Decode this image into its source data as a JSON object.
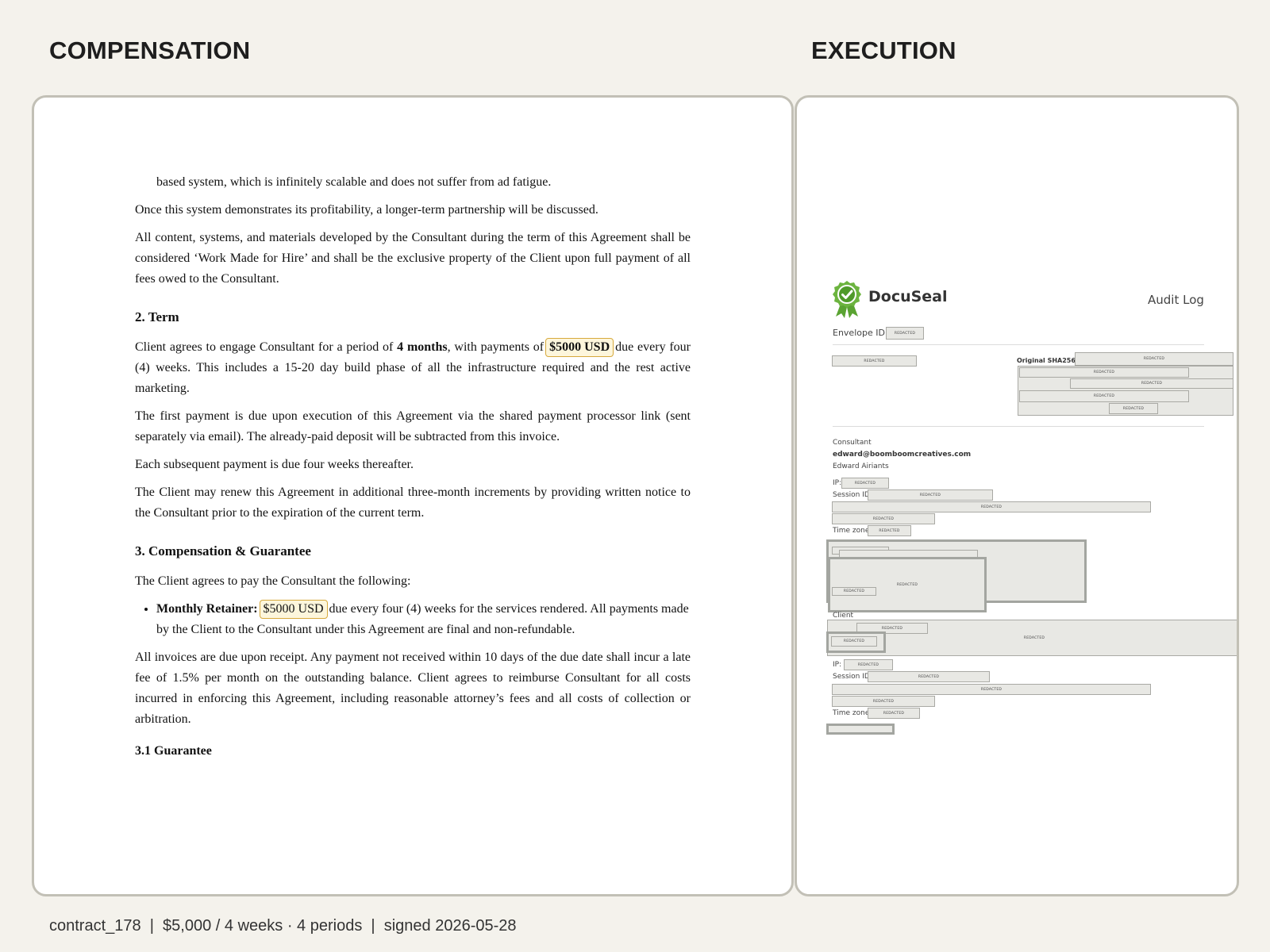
{
  "headings": {
    "left": "COMPENSATION",
    "right": "EXECUTION"
  },
  "doc": {
    "cut_line": "based system, which is infinitely scalable and does not suffer from ad fatigue.",
    "p_once": "Once this system demonstrates its profitability, a longer-term partnership will be discussed.",
    "p_content": "All content, systems, and materials developed by the Consultant during the term of this Agreement shall be considered ‘Work Made for Hire’ and shall be the exclusive property of the Client upon full payment of all fees owed to the Consultant.",
    "term_heading": "2. Term",
    "term_p1_a": "Client agrees to engage Consultant for a period of ",
    "term_p1_b": "4 months",
    "term_p1_c": ", with payments of",
    "term_p1_amount": "$5000 USD",
    "term_p1_d": "due every four (4) weeks. This includes a 15-20 day build phase of all the infrastructure required and the rest active marketing.",
    "term_p2": "The first payment is due upon execution of this Agreement via the shared payment processor link (sent separately via email). The already-paid deposit will be subtracted from this invoice.",
    "term_p3": "Each subsequent payment is due four weeks thereafter.",
    "term_p4": "The Client may renew this Agreement in additional three-month increments by providing written notice to the Consultant prior to the expiration of the current term.",
    "comp_heading": "3. Compensation & Guarantee",
    "comp_p1": "The Client agrees to pay the Consultant the following:",
    "retainer_label": "Monthly Retainer:",
    "retainer_amount": "$5000 USD",
    "retainer_text": "due every four (4) weeks for the services rendered. All payments made by the Client to the Consultant under this Agreement are final and non-refundable.",
    "comp_p2": "All invoices are due upon receipt. Any payment not received within 10 days of the due date shall incur a late fee of 1.5% per month on the outstanding balance. Client agrees to reimburse Consultant for all costs incurred in enforcing this Agreement, including reasonable attorney’s fees and all costs of collection or arbitration.",
    "guarantee_heading": "3.1 Guarantee"
  },
  "audit": {
    "brand": "DocuSeal",
    "title": "Audit Log",
    "envelope_label": "Envelope ID:",
    "sha_label": "Original SHA256:",
    "redacted": "REDACTED",
    "consultant_role": "Consultant",
    "consultant_email": "edward@boomboomcreatives.com",
    "consultant_name": "Edward Airiants",
    "client_role": "Client",
    "ip_label": "IP:",
    "session_label": "Session ID:",
    "timezone_label": "Time zone:"
  },
  "footer": "contract_178  |  $5,000 / 4 weeks · 4 periods  |  signed 2026-05-28",
  "colors": {
    "highlight_border": "#d7a93c",
    "highlight_fill": "#fdf6dc",
    "docuseal_green": "#6cb43f"
  }
}
